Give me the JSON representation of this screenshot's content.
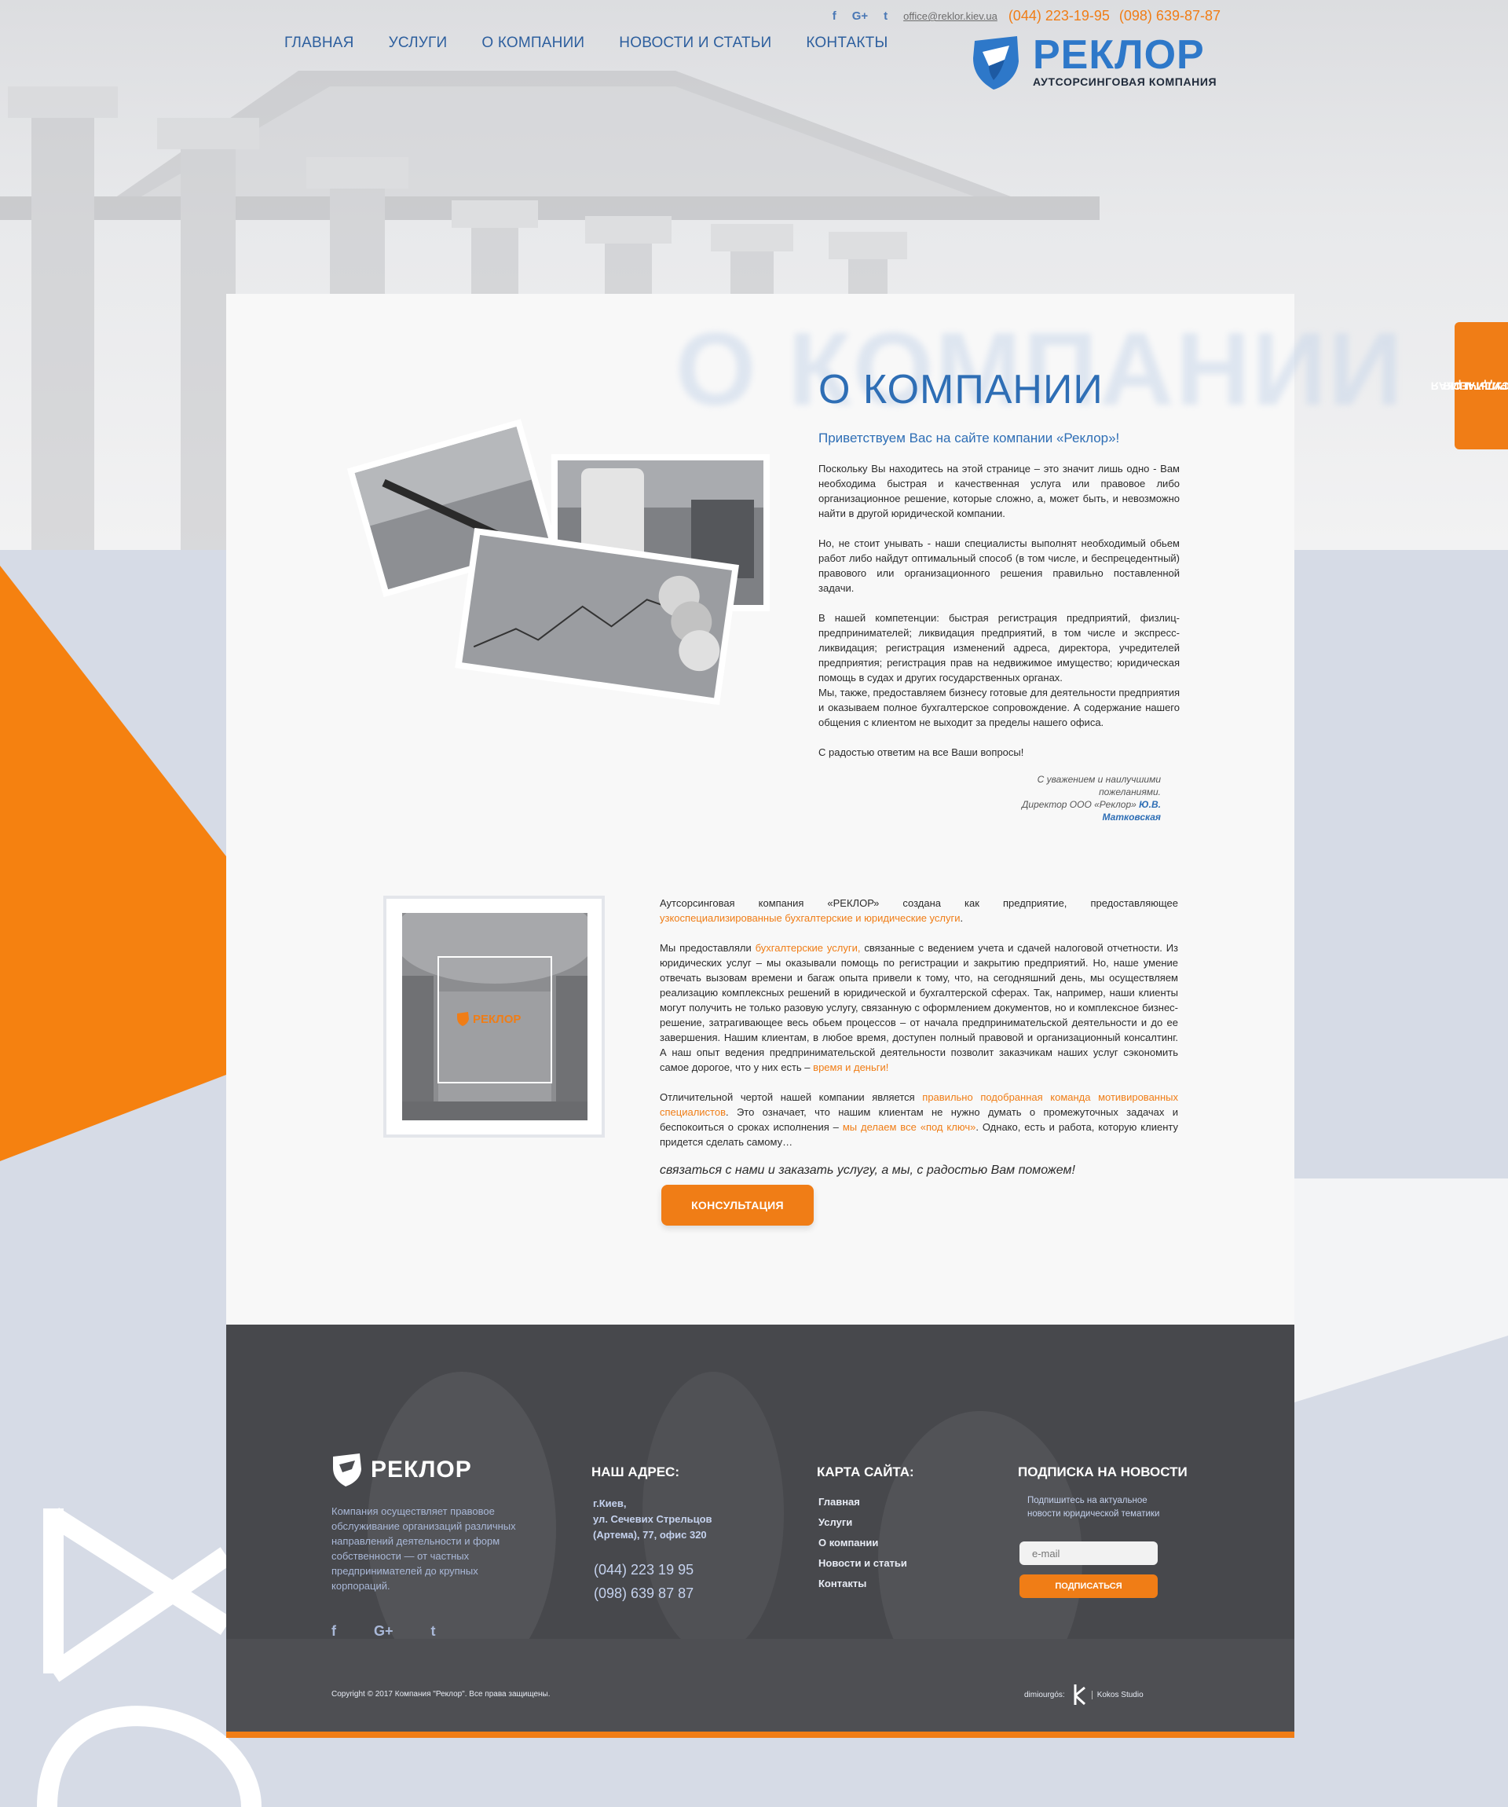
{
  "header": {
    "nav": [
      {
        "label": "ГЛАВНАЯ"
      },
      {
        "label": "УСЛУГИ"
      },
      {
        "label": "О КОМПАНИИ"
      },
      {
        "label": "НОВОСТИ И СТАТЬИ"
      },
      {
        "label": "КОНТАКТЫ"
      }
    ],
    "social": [
      "f",
      "G+",
      "t"
    ],
    "social_icons": [
      "facebook-icon",
      "google-plus-icon",
      "twitter-icon"
    ],
    "email": "office@reklor.kiev.ua",
    "phone1": "(044) 223-19-95",
    "phone2": "(098) 639-87-87",
    "logo_brand": "РЕКЛОР",
    "logo_tagline": "АУТСОРСИНГОВАЯ КОМПАНИЯ"
  },
  "side_tab": {
    "line1": "ЮРИДИЧЕСКАЯ",
    "line2": "КОНСУЛЬТАЦИЯ"
  },
  "about": {
    "ghost_title": "О КОМПАНИИ",
    "title": "О КОМПАНИИ",
    "greeting": "Приветствуем Вас на сайте компании «Реклор»!",
    "p1": "Поскольку Вы находитесь на этой странице – это значит лишь одно - Вам необходима быстрая и качественная услуга или правовое либо организационное решение, которые сложно, а, может быть, и невозможно найти в другой юридической компании.",
    "p2": "Но, не стоит унывать - наши специалисты выполнят необходимый обьем работ либо найдут оптимальный способ (в том числе, и беспрецедентный) правового или организационного решения правильно поставленной задачи.",
    "p3": "В нашей компетенции: быстрая регистрация предприятий, физлиц-предпринимателей; ликвидация предприятий, в том числе и экспресс-ликвидация; регистрация изменений адреса, директора, учредителей предприятия; регистрация прав на недвижимое имущество; юридическая помощь в судах и других государственных органах.",
    "p4": "Мы, также, предоставляем бизнесу готовые для деятельности предприятия и оказываем полное бухгалтерское сопровождение. А содержание нашего общения с клиентом не выходит за пределы нашего офиса.",
    "p5": "С радостью ответим на все Ваши вопросы!",
    "sign_line1": "С уважением и наилучшими пожеланиями.",
    "sign_line2": "Директор ООО «Реклор»",
    "sign_name": "Ю.В. Матковская"
  },
  "about2": {
    "photo_logo": "РЕКЛОР",
    "p1_a": "Аутсорсинговая компания «РЕКЛОР» создана как предприятие, предоставляющее ",
    "p1_hl": "узкоспециализированные бухгалтерские и юридические услуги",
    "p1_b": ".",
    "p2_a": "Мы предоставляли ",
    "p2_hl": "бухгалтерские услуги,",
    "p2_b": " связанные с ведением учета и сдачей налоговой отчетности. Из юридических услуг – мы оказывали помощь по регистрации и закрытию предприятий. Но, наше умение отвечать вызовам времени и багаж опыта привели к тому, что, на сегодняшний день, мы осуществляем реализацию комплексных решений в юридической и бухгалтерской сферах. Так, например, наши клиенты могут получить не только разовую услугу, связанную с оформлением документов, но и комплексное бизнес-решение, затрагивающее весь обьем процессов – от начала предпринимательской деятельности и до ее завершения. Нашим клиентам, в любое время, доступен полный правовой и организационный консалтинг. А наш опыт ведения предпринимательской деятельности позволит заказчикам наших услуг сэкономить самое дорогое, что у них есть – ",
    "p2_hl2": "время и деньги!",
    "p3_a": "Отличительной чертой нашей компании является ",
    "p3_hl": "правильно подобранная команда мотивированных специалистов",
    "p3_b": ". Это означает, что нашим клиентам не нужно думать о промежуточных задачах и беспокоиться о сроках исполнения – ",
    "p3_hl2": "мы делаем все «под ключ»",
    "p3_c": ". Однако, есть и работа, которую клиенту придется сделать самому…",
    "call": "связаться с нами и заказать услугу, а мы, с радостью Вам поможем!",
    "button": "КОНСУЛЬТАЦИЯ"
  },
  "footer": {
    "brand": "РЕКЛОР",
    "desc": "Компания осуществляет правовое обслуживание организаций различных направлений деятельности и форм собственности — от частных предпринимателей до крупных корпораций.",
    "address_head": "НАШ АДРЕС:",
    "address_1": "г.Киев,",
    "address_2": "ул. Сечевих Стрельцов",
    "address_3": "(Артема), 77, офис 320",
    "phone1": "(044) 223 19 95",
    "phone2": "(098) 639 87 87",
    "sitemap_head": "КАРТА САЙТА:",
    "sitemap": [
      {
        "label": "Главная"
      },
      {
        "label": "Услуги"
      },
      {
        "label": "О компании"
      },
      {
        "label": "Новости и статьи"
      },
      {
        "label": "Контакты"
      }
    ],
    "subscribe_head": "ПОДПИСКА НА НОВОСТИ",
    "subscribe_note": "Подпишитесь на актуальное новости юридической тематики",
    "email_placeholder": "e-mail",
    "subscribe_button": "ПОДПИСАТЬСЯ",
    "social": [
      "f",
      "G+",
      "t"
    ],
    "copyright": "Copyright © 2017 Компания \"Реклор\". Все права защищены.",
    "dev_label": "dimiourgós:",
    "dev_studio": "Kokos Studio",
    "colors": {
      "accent": "#f07d16",
      "brand_blue": "#2e6eb5",
      "footer_bg": "#4b4c50"
    }
  }
}
